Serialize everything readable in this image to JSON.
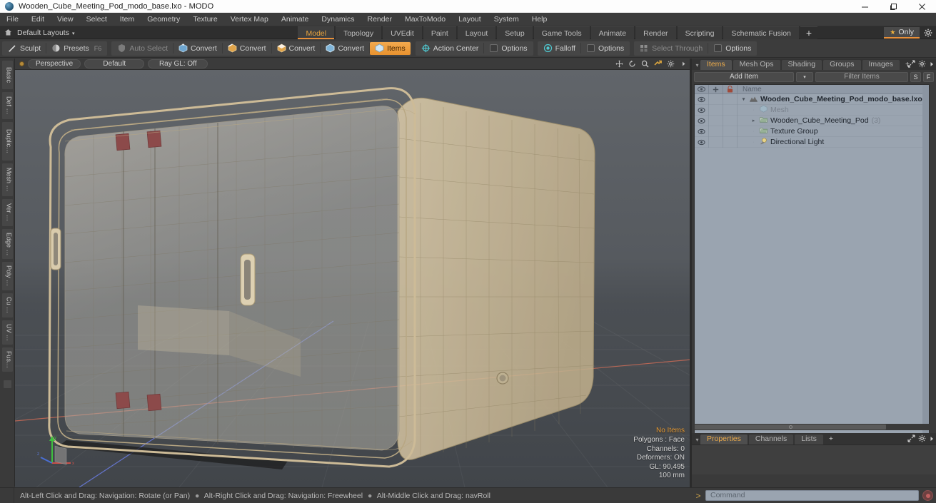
{
  "window": {
    "title": "Wooden_Cube_Meeting_Pod_modo_base.lxo - MODO",
    "app_icon": "modo-app-icon",
    "minimize": "–",
    "maximize": "❐",
    "close": "✕"
  },
  "menu": {
    "items": [
      {
        "label": "File"
      },
      {
        "label": "Edit"
      },
      {
        "label": "View"
      },
      {
        "label": "Select"
      },
      {
        "label": "Item"
      },
      {
        "label": "Geometry"
      },
      {
        "label": "Texture"
      },
      {
        "label": "Vertex Map"
      },
      {
        "label": "Animate"
      },
      {
        "label": "Dynamics"
      },
      {
        "label": "Render"
      },
      {
        "label": "MaxToModo"
      },
      {
        "label": "Layout"
      },
      {
        "label": "System"
      },
      {
        "label": "Help"
      }
    ]
  },
  "layoutbar": {
    "preset_label": "Default Layouts",
    "preset_caret": "▾",
    "home_icon": "home-layout-icon",
    "tabs": [
      {
        "label": "Model",
        "active": true
      },
      {
        "label": "Topology",
        "active": false
      },
      {
        "label": "UVEdit",
        "active": false
      },
      {
        "label": "Paint",
        "active": false
      },
      {
        "label": "Layout",
        "active": false
      },
      {
        "label": "Setup",
        "active": false
      },
      {
        "label": "Game Tools",
        "active": false
      },
      {
        "label": "Animate",
        "active": false
      },
      {
        "label": "Render",
        "active": false
      },
      {
        "label": "Scripting",
        "active": false
      },
      {
        "label": "Schematic Fusion",
        "active": false
      }
    ],
    "add_tab": "+",
    "only_label": "Only",
    "only_star_icon": "star-icon",
    "gear_icon": "gear-icon"
  },
  "toolbar": {
    "groups": [
      {
        "buttons": [
          {
            "label": "Sculpt",
            "icon": "brush-icon",
            "state": "normal"
          },
          {
            "label": "Presets",
            "icon": "sphere-icon",
            "state": "normal",
            "shortcut": "F6"
          }
        ]
      },
      {
        "buttons": [
          {
            "label": "Auto Select",
            "icon": "shield-icon",
            "state": "dim"
          },
          {
            "label": "Convert",
            "icon": "vertex-cube-icon",
            "state": "normal"
          },
          {
            "label": "Convert",
            "icon": "edge-cube-icon",
            "state": "normal"
          },
          {
            "label": "Convert",
            "icon": "polygon-cube-icon",
            "state": "normal"
          },
          {
            "label": "Convert",
            "icon": "item-cube-icon",
            "state": "normal"
          },
          {
            "label": "Items",
            "icon": "items-icon",
            "state": "active"
          }
        ]
      },
      {
        "buttons": [
          {
            "label": "Action Center",
            "icon": "action-center-icon",
            "state": "normal"
          },
          {
            "label": "Options",
            "icon": "options-box-icon",
            "state": "normal"
          }
        ]
      },
      {
        "buttons": [
          {
            "label": "Falloff",
            "icon": "falloff-icon",
            "state": "normal"
          },
          {
            "label": "Options",
            "icon": "options-box-icon",
            "state": "normal"
          }
        ]
      },
      {
        "buttons": [
          {
            "label": "Select Through",
            "icon": "select-through-icon",
            "state": "dim"
          },
          {
            "label": "Options",
            "icon": "options-box-icon",
            "state": "normal"
          }
        ]
      }
    ]
  },
  "vertical_tools": {
    "tabs": [
      {
        "label": "Basic"
      },
      {
        "label": "Def …"
      },
      {
        "label": "Duplic…"
      },
      {
        "label": "Mesh …"
      },
      {
        "label": "Ver …"
      },
      {
        "label": "Edge …"
      },
      {
        "label": "Poly …"
      },
      {
        "label": "Cu …"
      },
      {
        "label": "UV …"
      },
      {
        "label": "Fus…"
      }
    ]
  },
  "viewport": {
    "header": {
      "indicator": "active-viewport-dot",
      "view_mode": "Perspective",
      "shading": "Default",
      "raygl": "Ray GL: Off",
      "nav_icons": [
        "pan-icon",
        "rotate-icon",
        "zoom-icon",
        "fit-icon",
        "gear-icon",
        "chevron-right-icon"
      ]
    },
    "stats": {
      "selection": "No Items",
      "polygons": "Polygons : Face",
      "channels": "Channels: 0",
      "deformers": "Deformers: ON",
      "gl": "GL: 90,495",
      "scale": "100 mm"
    },
    "axis_gizmo": {
      "x": "x",
      "y": "y",
      "z": "z"
    },
    "model_name": "wooden-cube-meeting-pod-wireframe"
  },
  "items_panel": {
    "tabs": [
      {
        "label": "Items",
        "active": true
      },
      {
        "label": "Mesh Ops",
        "active": false
      },
      {
        "label": "Shading",
        "active": false
      },
      {
        "label": "Groups",
        "active": false
      },
      {
        "label": "Images",
        "active": false
      }
    ],
    "add_tab": "+",
    "expand_icon": "expand-icon",
    "gear_icon": "gear-icon",
    "chevron_icon": "chevron-right-icon",
    "add_item_label": "Add Item",
    "add_item_caret": "▾",
    "filter_placeholder": "Filter Items",
    "btn_s": "S",
    "btn_f": "F",
    "columns": {
      "eye": "visibility-column",
      "plus": "add-column",
      "lock": "lock-column",
      "name": "Name"
    },
    "rows": [
      {
        "name": "Wooden_Cube_Meeting_Pod_modo_base.lxo",
        "icon": "scene-icon",
        "indent": 0,
        "triangle": "▾",
        "bold": true,
        "dim": false,
        "count": ""
      },
      {
        "name": "Mesh",
        "icon": "mesh-icon",
        "indent": 1,
        "triangle": "·",
        "bold": false,
        "dim": true,
        "count": ""
      },
      {
        "name": "Wooden_Cube_Meeting_Pod",
        "icon": "group-icon",
        "indent": 1,
        "triangle": "▸",
        "bold": false,
        "dim": false,
        "count": "(3)"
      },
      {
        "name": "Texture Group",
        "icon": "group-icon",
        "indent": 1,
        "triangle": "·",
        "bold": false,
        "dim": false,
        "count": ""
      },
      {
        "name": "Directional Light",
        "icon": "light-icon",
        "indent": 1,
        "triangle": "·",
        "bold": false,
        "dim": false,
        "count": ""
      }
    ]
  },
  "properties_panel": {
    "tabs": [
      {
        "label": "Properties",
        "active": true
      },
      {
        "label": "Channels",
        "active": false
      },
      {
        "label": "Lists",
        "active": false
      }
    ],
    "add_tab": "+",
    "expand_icon": "expand-icon",
    "gear_icon": "gear-icon",
    "chevron_icon": "chevron-right-icon"
  },
  "command_bar": {
    "prompt": ">",
    "placeholder": "Command",
    "record_icon": "record-icon"
  },
  "status_bar": {
    "hints": [
      "Alt-Left Click and Drag: Navigation: Rotate (or Pan)",
      "Alt-Right Click and Drag: Navigation: Freewheel",
      "Alt-Middle Click and Drag: navRoll"
    ],
    "separator": "●"
  },
  "colors": {
    "accent_orange": "#e8903a",
    "panel_bg": "#3a3a3a",
    "tree_bg": "#9aa4b0",
    "titlebar_bg": "#fdfdfd",
    "axis_x": "#e07058",
    "axis_z": "#6e82f0",
    "axis_y": "#4fc24f",
    "wire": "#d8c8a8"
  }
}
